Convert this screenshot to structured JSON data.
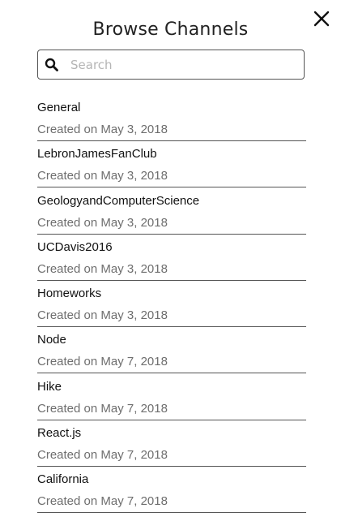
{
  "modal": {
    "title": "Browse Channels",
    "close_icon": "close-icon"
  },
  "search": {
    "icon": "search-icon",
    "placeholder": "Search",
    "value": ""
  },
  "channels": [
    {
      "name": "General",
      "created": "Created on May 3, 2018"
    },
    {
      "name": "LebronJamesFanClub",
      "created": "Created on May 3, 2018"
    },
    {
      "name": "GeologyandComputerScience",
      "created": "Created on May 3, 2018"
    },
    {
      "name": "UCDavis2016",
      "created": "Created on May 3, 2018"
    },
    {
      "name": "Homeworks",
      "created": "Created on May 3, 2018"
    },
    {
      "name": "Node",
      "created": "Created on May 7, 2018"
    },
    {
      "name": "Hike",
      "created": "Created on May 7, 2018"
    },
    {
      "name": "React.js",
      "created": "Created on May 7, 2018"
    },
    {
      "name": "California",
      "created": "Created on May 7, 2018"
    }
  ]
}
